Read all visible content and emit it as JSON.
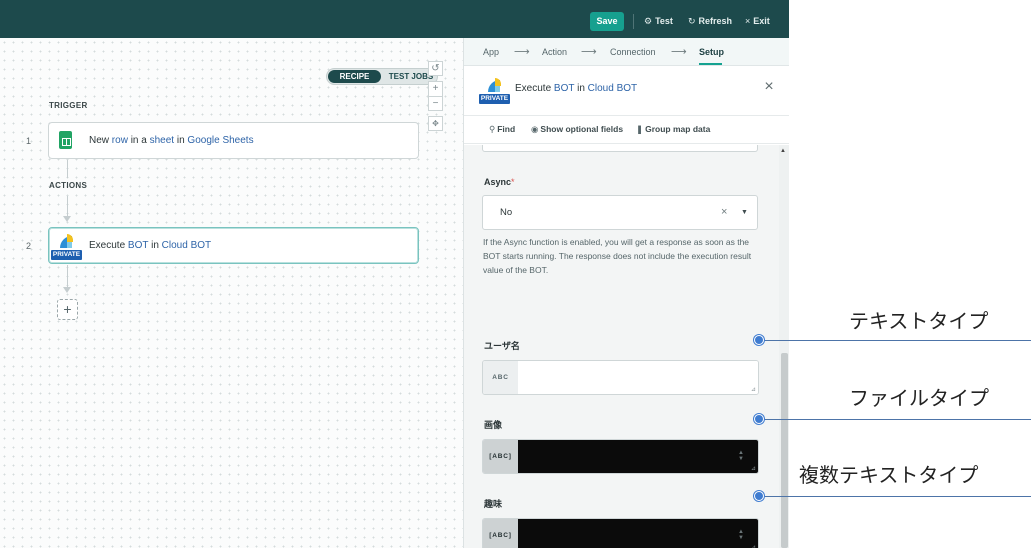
{
  "topbar": {
    "save_label": "Save",
    "test_label": "Test",
    "refresh_label": "Refresh",
    "exit_label": "Exit"
  },
  "canvas": {
    "toggle": {
      "recipe": "RECIPE",
      "test_jobs": "TEST JOBS"
    },
    "trigger_label": "TRIGGER",
    "actions_label": "ACTIONS",
    "step1": {
      "number": "1",
      "parts": [
        "New ",
        "row",
        " in a ",
        "sheet",
        " in ",
        "Google Sheets"
      ]
    },
    "step2": {
      "number": "2",
      "parts": [
        "Execute ",
        "BOT",
        " in ",
        "Cloud BOT"
      ],
      "badge": "PRIVATE"
    },
    "add_label": "+"
  },
  "panel": {
    "breadcrumbs": [
      "App",
      "Action",
      "Connection",
      "Setup"
    ],
    "header": {
      "parts": [
        "Execute ",
        "BOT",
        " in ",
        "Cloud BOT"
      ],
      "badge": "PRIVATE"
    },
    "tools": {
      "find": "Find",
      "optional": "Show optional fields",
      "group": "Group map data"
    },
    "async": {
      "label": "Async",
      "required_mark": "*",
      "value": "No",
      "help": "If the Async function is enabled, you will get a response as soon as the BOT starts running. The response does not include the execution result value of the BOT."
    },
    "fields": [
      {
        "label": "ユーザ名",
        "type_tag": "ABC"
      },
      {
        "label": "画像",
        "type_tag": "[ABC]"
      },
      {
        "label": "趣味",
        "type_tag": "[ABC]"
      }
    ]
  },
  "callouts": [
    {
      "text": "テキストタイプ"
    },
    {
      "text": "ファイルタイプ"
    },
    {
      "text": "複数テキストタイプ"
    }
  ],
  "colors": {
    "topbar": "#1d4a4c",
    "save": "#16a08f",
    "link": "#2e64a8",
    "private": "#1e5fb0",
    "callout": "#3f7cd0"
  }
}
